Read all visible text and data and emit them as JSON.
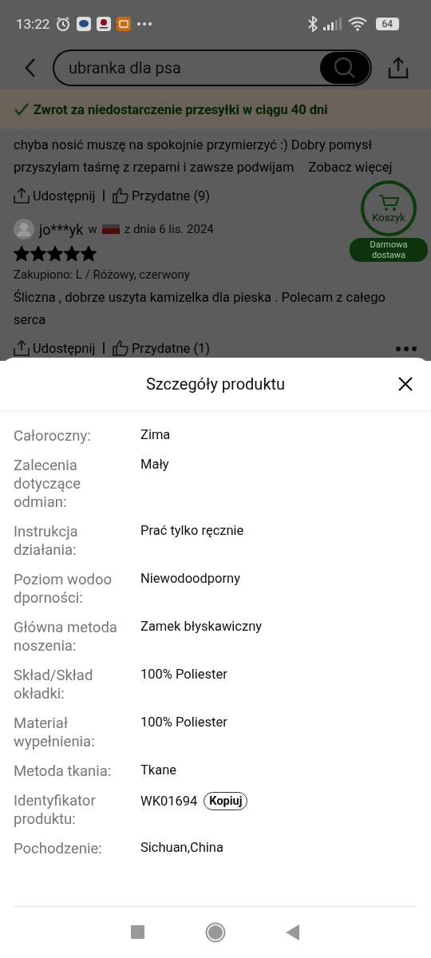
{
  "status_bar": {
    "time": "13:22",
    "battery": "64"
  },
  "header": {
    "search": {
      "value": "ubranka dla psa"
    }
  },
  "banner": {
    "text": "Zwrot za niedostarczenie przesyłki w ciągu 40 dni"
  },
  "reviews": [
    {
      "text": "chyba nosić muszę na spokojnie przymierzyć :) Dobry pomysł przyszylam taśmę z rzepami i zawsze podwijam",
      "more": "Zobacz więcej",
      "share": "Udostępnij",
      "helpful": "Przydatne (9)"
    },
    {
      "user": "jo***yk",
      "country_prefix": "w",
      "date": "z dnia 6 lis. 2024",
      "stars": 5,
      "purchased": "Zakupiono: L / Różowy, czerwony",
      "text": "Śliczna , dobrze uszyta kamizelka dla pieska . Polecam z całego serca",
      "share": "Udostępnij",
      "helpful": "Przydatne (1)"
    }
  ],
  "cart_button": {
    "label": "Koszyk",
    "badge": "Darmowa dostawa"
  },
  "sheet": {
    "title": "Szczegóły produktu",
    "rows": [
      {
        "label": "Całoroczny:",
        "value": "Zima"
      },
      {
        "label": "Zalecenia dotyczące odmian:",
        "value": "Mały"
      },
      {
        "label": "Instrukcja działania:",
        "value": "Prać tylko ręcznie"
      },
      {
        "label": "Poziom wodoo dporności:",
        "value": "Niewodoodporny"
      },
      {
        "label": "Główna metoda noszenia:",
        "value": "Zamek błyskawiczny"
      },
      {
        "label": "Skład/Skład okładki:",
        "value": "100% Poliester"
      },
      {
        "label": "Materiał wypełnienia:",
        "value": "100% Poliester"
      },
      {
        "label": "Metoda tkania:",
        "value": "Tkane"
      },
      {
        "label": "Identyfikator produktu:",
        "value": "WK01694",
        "action": "Kopiuj"
      },
      {
        "label": "Pochodzenie:",
        "value": "Sichuan,China"
      }
    ]
  }
}
